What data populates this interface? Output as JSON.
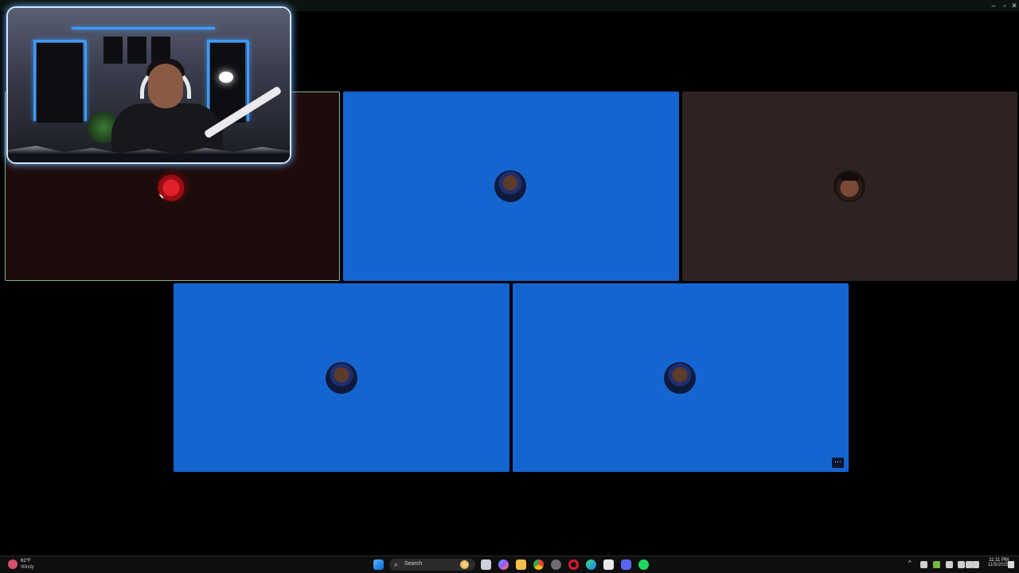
{
  "window": {
    "controls": {
      "minimize": "–",
      "maximize": "▫",
      "close": "✕"
    }
  },
  "tiles": [
    {
      "id": "tile-1",
      "background": "#1e0c0c",
      "avatar": "red-avatar",
      "muted": true,
      "active_speaker": true
    },
    {
      "id": "tile-2",
      "background": "#1565d0",
      "avatar": "blue-avatar"
    },
    {
      "id": "tile-3",
      "background": "#2e2322",
      "avatar": "face-avatar"
    },
    {
      "id": "tile-4",
      "background": "#1565d0",
      "avatar": "blue-avatar"
    },
    {
      "id": "tile-5",
      "background": "#1565d0",
      "avatar": "blue-avatar",
      "more_options": "···"
    }
  ],
  "mute_glyph": "✕",
  "taskbar": {
    "weather": {
      "temp": "62°F",
      "condition": "Windy",
      "icon": "weather-icon"
    },
    "search": {
      "label": "Search",
      "icon": "search-icon"
    },
    "pinned_apps": [
      "windows-start-icon",
      "task-view-icon",
      "copilot-icon",
      "file-explorer-icon",
      "chrome-icon",
      "settings-icon",
      "opera-icon",
      "edge-icon",
      "capcut-icon",
      "discord-icon",
      "spotify-icon"
    ],
    "tray": {
      "chevron": "^",
      "icons": [
        "onedrive-icon",
        "nvidia-icon",
        "microphone-icon",
        "display-icon",
        "wifi-icon",
        "volume-icon"
      ]
    },
    "clock": {
      "time": "11:11 PM",
      "date": "11/5/2025"
    }
  },
  "colors": {
    "accent_blue": "#1565d0",
    "speaker_border": "#7fb98c",
    "webcam_glow": "#6fb6ff"
  }
}
